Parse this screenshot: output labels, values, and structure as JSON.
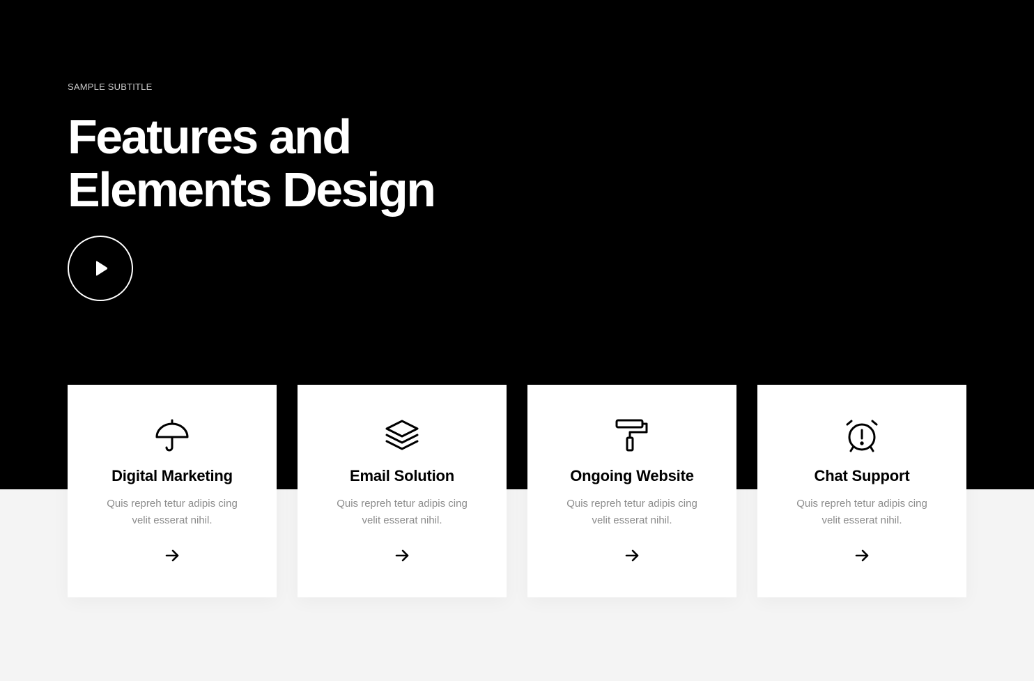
{
  "hero": {
    "subtitle": "SAMPLE SUBTITLE",
    "title_line1": "Features and",
    "title_line2": "Elements Design",
    "play_icon": "play-icon"
  },
  "colors": {
    "hero_bg": "#000000",
    "page_bg": "#f4f4f4",
    "card_bg": "#ffffff",
    "text_dark": "#000000",
    "text_muted": "#8c8c8c"
  },
  "features": [
    {
      "icon": "umbrella-icon",
      "title": "Digital Marketing",
      "desc_line1": "Quis repreh tetur adipis cing",
      "desc_line2": "velit esserat nihil.",
      "arrow_icon": "arrow-right-icon"
    },
    {
      "icon": "layers-icon",
      "title": "Email Solution",
      "desc_line1": "Quis repreh tetur adipis cing",
      "desc_line2": "velit esserat nihil.",
      "arrow_icon": "arrow-right-icon"
    },
    {
      "icon": "paint-roller-icon",
      "title": "Ongoing Website",
      "desc_line1": "Quis repreh tetur adipis cing",
      "desc_line2": "velit esserat nihil.",
      "arrow_icon": "arrow-right-icon"
    },
    {
      "icon": "alarm-clock-icon",
      "title": "Chat Support",
      "desc_line1": "Quis repreh tetur adipis cing",
      "desc_line2": "velit esserat nihil.",
      "arrow_icon": "arrow-right-icon"
    }
  ]
}
